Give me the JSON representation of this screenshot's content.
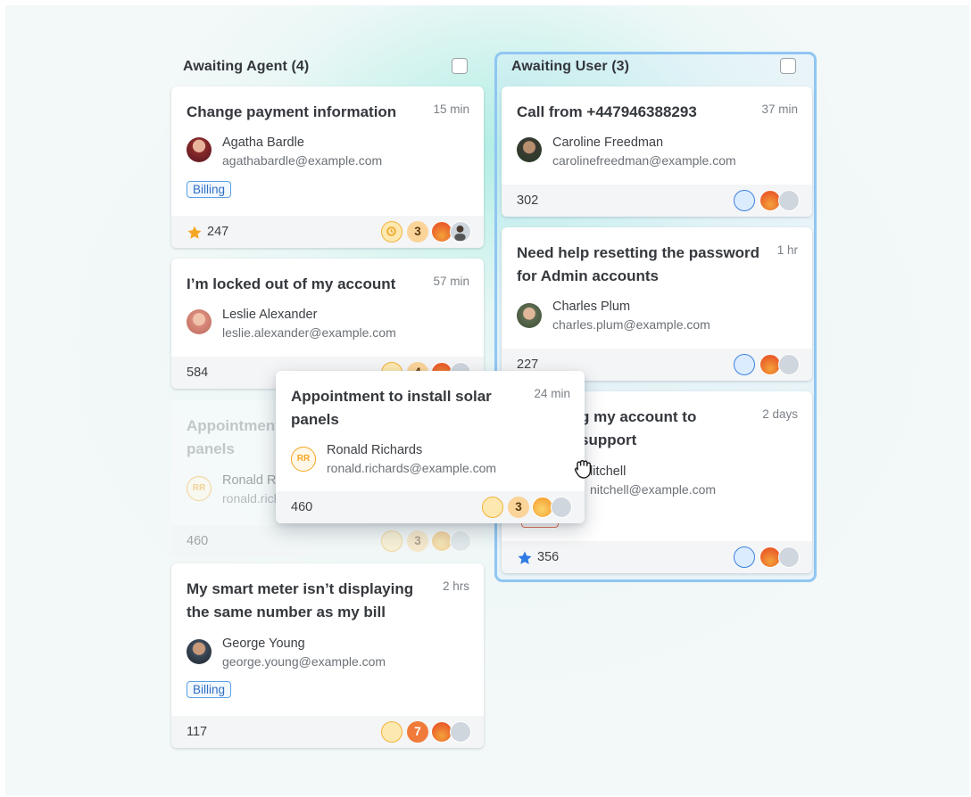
{
  "columns": [
    {
      "header": "Awaiting Agent (4)",
      "cards": [
        {
          "title": "Change payment information",
          "time": "15 min",
          "name": "Agatha Bardle",
          "email": "agathabardle@example.com",
          "tag": "Billing",
          "count": "247",
          "starred": true,
          "priority": "3"
        },
        {
          "title": "I’m locked out of my account",
          "time": "57 min",
          "name": "Leslie Alexander",
          "email": "leslie.alexander@example.com",
          "count": "584",
          "priority": "4"
        },
        {
          "title_line1": "Appointment to install solar",
          "title_line2": "panels",
          "name": "Ronald Richards",
          "email": "ronald.richards@example.com",
          "initials": "RR",
          "count": "460",
          "priority": "3",
          "ghost": true
        },
        {
          "title_line1": "My smart meter isn’t displaying",
          "title_line2": "the same number as my bill",
          "time": "2 hrs",
          "name": "George Young",
          "email": "george.young@example.com",
          "tag": "Billing",
          "count": "117",
          "priority": "7"
        }
      ]
    },
    {
      "header": "Awaiting User (3)",
      "cards": [
        {
          "title": "Call from +447946388293",
          "time": "37 min",
          "name": "Caroline Freedman",
          "email": "carolinefreedman@example.com",
          "count": "302"
        },
        {
          "title_line1": "Need help resetting the password",
          "title_line2": "for Admin accounts",
          "time": "1 hr",
          "name": "Charles Plum",
          "email": "charles.plum@example.com",
          "count": "227"
        },
        {
          "title_line1": "g my account to",
          "title_line2": "support",
          "time": "2 days",
          "name": "litchell",
          "email": "nitchell@example.com",
          "count": "356",
          "starred": true
        }
      ]
    }
  ],
  "dragged_card": {
    "title_line1": "Appointment to install solar",
    "title_line2": "panels",
    "time": "24 min",
    "name": "Ronald Richards",
    "email": "ronald.richards@example.com",
    "initials": "RR",
    "count": "460",
    "priority": "3"
  },
  "icons": {
    "clock": "clock-icon",
    "star": "star-icon",
    "assign": "assign-user-icon",
    "cursor": "grab-hand-icon"
  },
  "colors": {
    "accent_blue": "#3b82e0",
    "column_outline": "#90c6f3",
    "star_orange": "#f5a623",
    "star_blue": "#2f7be5",
    "tag_blue": "#2f6fc2"
  }
}
